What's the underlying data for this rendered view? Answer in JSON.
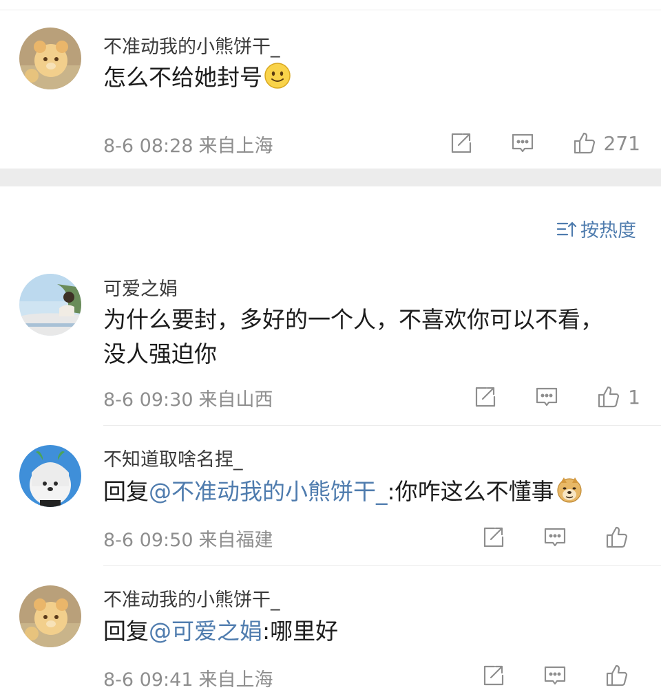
{
  "top_comment": {
    "username": "不准动我的小熊饼干_",
    "text": "怎么不给她封号",
    "emoji": "smile-emoji",
    "time": "8-6 08:28",
    "location": "来自上海",
    "likes": "271"
  },
  "sort": {
    "label": "按热度",
    "icon": "sort-icon"
  },
  "replies": [
    {
      "username": "可爱之娟",
      "text_line1": "为什么要封，多好的一个人，不喜欢你可以不看，",
      "text_line2": "没人强迫你",
      "time": "8-6 09:30",
      "location": "来自山西",
      "likes": "1"
    },
    {
      "username": "不知道取啥名捏_",
      "reply_prefix": "回复",
      "mention": "@不准动我的小熊饼干_",
      "text": ":你咋这么不懂事",
      "emoji": "doge-emoji",
      "time": "8-6 09:50",
      "location": "来自福建",
      "likes": ""
    },
    {
      "username": "不准动我的小熊饼干_",
      "reply_prefix": "回复",
      "mention": "@可爱之娟",
      "text": ":哪里好",
      "time": "8-6 09:41",
      "location": "来自上海",
      "likes": ""
    }
  ],
  "icons": {
    "share": "share-icon",
    "comment": "comment-icon",
    "like": "thumbs-up-icon"
  },
  "colors": {
    "mention": "#4f7cae",
    "meta": "#8e8e8e",
    "separator": "#ececec"
  }
}
